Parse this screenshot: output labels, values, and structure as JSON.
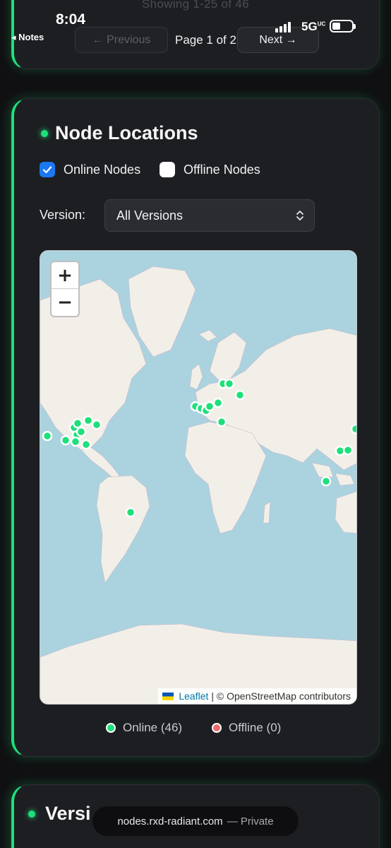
{
  "status_bar": {
    "time": "8:04",
    "back_label": "◂ Notes",
    "network": "5G",
    "network_sup": "UC"
  },
  "pagination": {
    "showing": "Showing 1-25 of 46",
    "previous_label": "← Previous",
    "page_info": "Page 1 of 2",
    "next_label": "Next →"
  },
  "node_locations": {
    "title": "Node Locations",
    "filters": [
      {
        "label": "Online Nodes",
        "checked": true
      },
      {
        "label": "Offline Nodes",
        "checked": false
      }
    ],
    "version_label": "Version:",
    "version_value": "All Versions",
    "map": {
      "zoom_in": "+",
      "zoom_out": "−",
      "attribution_leaflet": "Leaflet",
      "attribution_rest": "| © OpenStreetMap contributors"
    },
    "legend": [
      {
        "label": "Online (46)",
        "color": "#1ee07a"
      },
      {
        "label": "Offline (0)",
        "color": "#f06a6a"
      }
    ]
  },
  "next_section": {
    "title_partial": "Versi"
  },
  "browser": {
    "host": "nodes.rxd-radiant.com",
    "mode": "— Private"
  },
  "colors": {
    "accent": "#1ee07a",
    "checkbox": "#1a78f2",
    "offline": "#f06a6a"
  }
}
